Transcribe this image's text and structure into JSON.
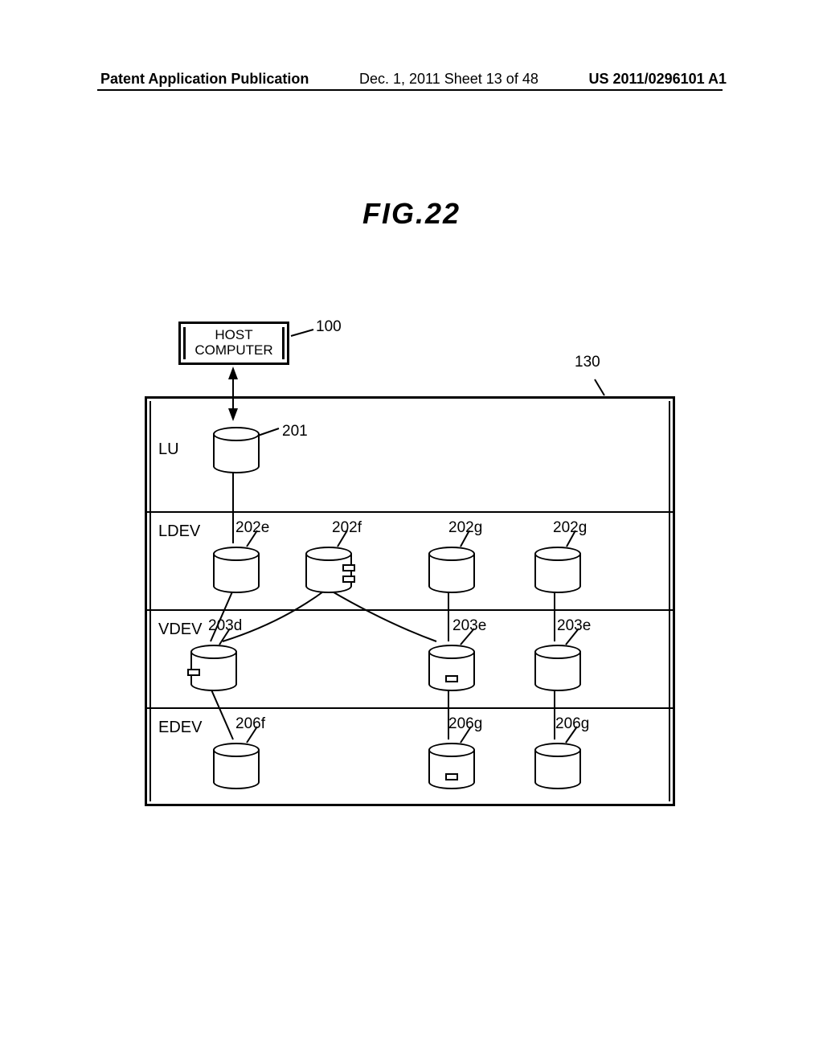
{
  "header": {
    "left": "Patent Application Publication",
    "center": "Dec. 1, 2011   Sheet 13 of 48",
    "right": "US 2011/0296101 A1"
  },
  "figure": {
    "title": "FIG.22",
    "host_label": "HOST\nCOMPUTER",
    "refs": {
      "host": "100",
      "storage": "130",
      "lu_cyl": "201",
      "ldev": [
        "202e",
        "202f",
        "202g",
        "202g"
      ],
      "vdev": [
        "203d",
        "203e",
        "203e"
      ],
      "edev": [
        "206f",
        "206g",
        "206g"
      ]
    },
    "row_labels": {
      "lu": "LU",
      "ldev": "LDEV",
      "vdev": "VDEV",
      "edev": "EDEV"
    }
  }
}
